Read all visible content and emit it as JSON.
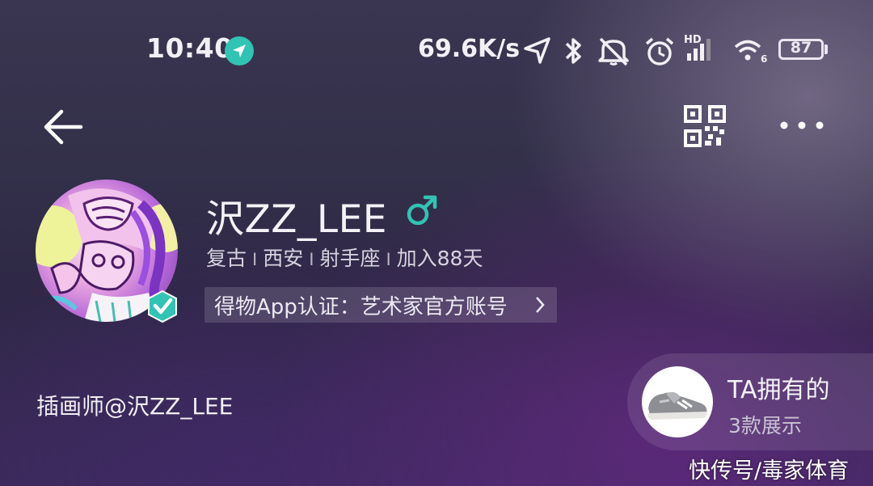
{
  "status_bar": {
    "time": "10:40",
    "net_speed": "69.6K/s",
    "wifi_sub": "6",
    "hd_label": "HD",
    "battery": "87",
    "icons": [
      "location-arrow-icon",
      "bluetooth-icon",
      "mute-icon",
      "alarm-icon",
      "signal-icon",
      "wifi-icon",
      "battery-icon"
    ]
  },
  "nav": {
    "icons": [
      "back-arrow-icon",
      "qr-code-icon",
      "more-dots-icon"
    ]
  },
  "profile": {
    "username": "沢ZZ_LEE",
    "gender_symbol": "♂",
    "meta": [
      "复古",
      "西安",
      "射手座",
      "加入88天"
    ],
    "meta_separator": "I",
    "certification": "得物App认证：艺术家官方账号",
    "bio": "插画师@沢ZZ_LEE"
  },
  "owned_card": {
    "title": "TA拥有的",
    "count": "3款展示"
  },
  "watermark": "快传号/毒家体育",
  "colors": {
    "accent_teal": "#31c3b3",
    "text_primary": "#f4f2f7",
    "text_secondary": "#d7d3df"
  }
}
